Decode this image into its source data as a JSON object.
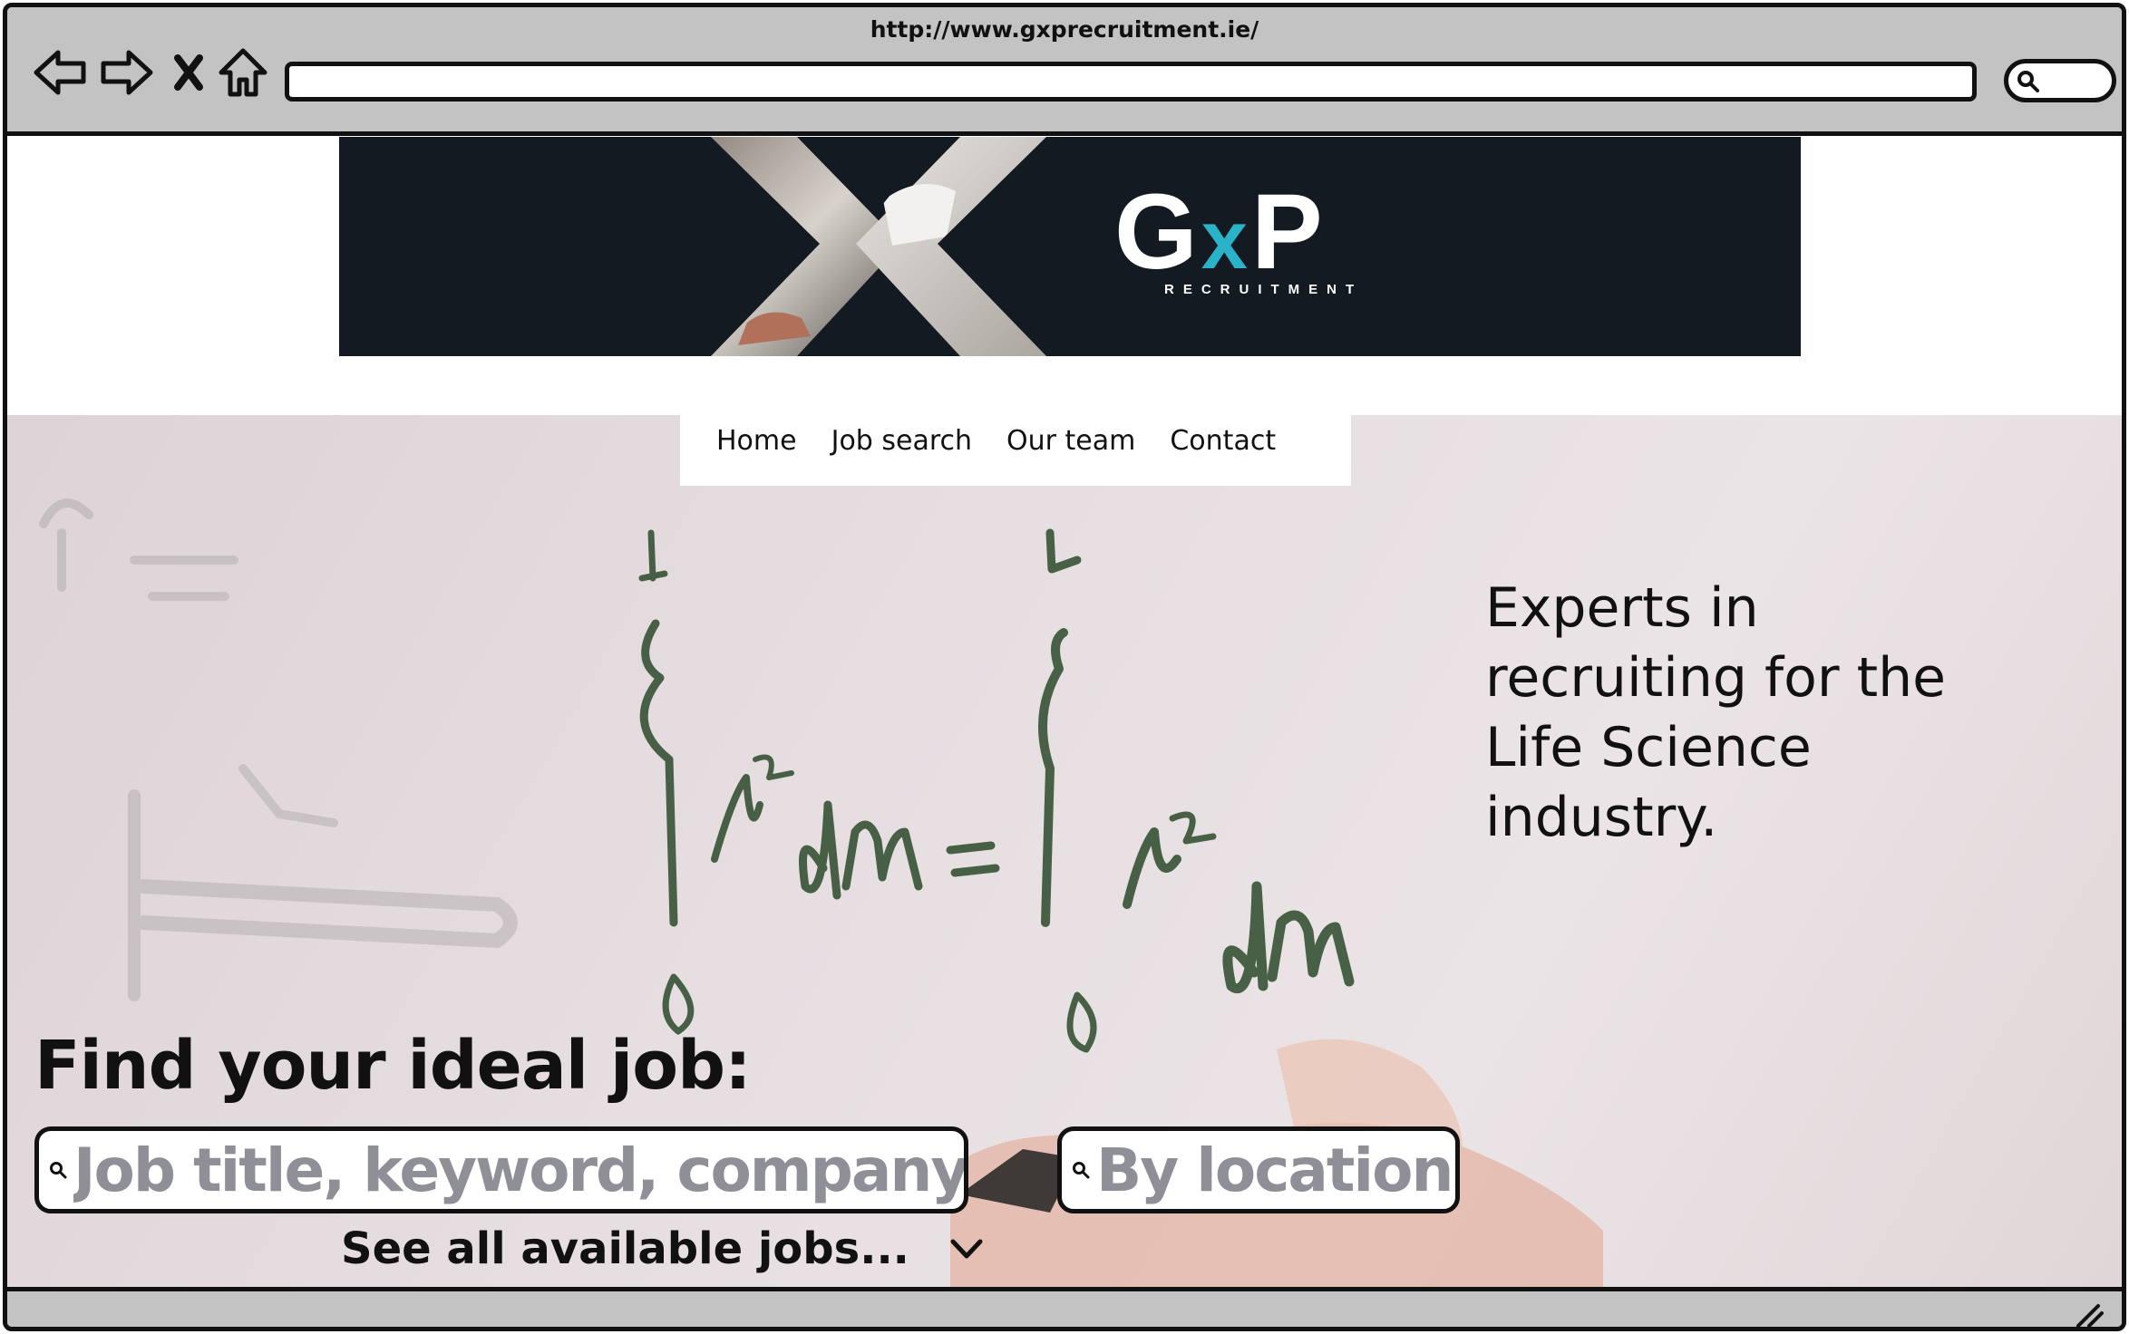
{
  "browser": {
    "url": "http://www.gxprecruitment.ie/",
    "icons": [
      "back-arrow-icon",
      "forward-arrow-icon",
      "close-icon",
      "home-icon",
      "search-icon"
    ]
  },
  "banner": {
    "logo_left": "G",
    "logo_x": "x",
    "logo_right": "P",
    "logo_tagline": "RECRUITMENT",
    "colors": {
      "background": "#141a22",
      "accent": "#2ab2c8",
      "text": "#ffffff"
    }
  },
  "nav": {
    "items": [
      {
        "label": "Home"
      },
      {
        "label": "Job search"
      },
      {
        "label": "Our team"
      },
      {
        "label": "Contact"
      }
    ]
  },
  "hero": {
    "tagline_lines": [
      "Experts in",
      "recruiting for the",
      "Life Science",
      "industry."
    ],
    "find_heading": "Find your ideal job:",
    "job_search_placeholder": "Job title, keyword, company",
    "location_placeholder": "By location",
    "see_all": "See all available jobs..."
  }
}
